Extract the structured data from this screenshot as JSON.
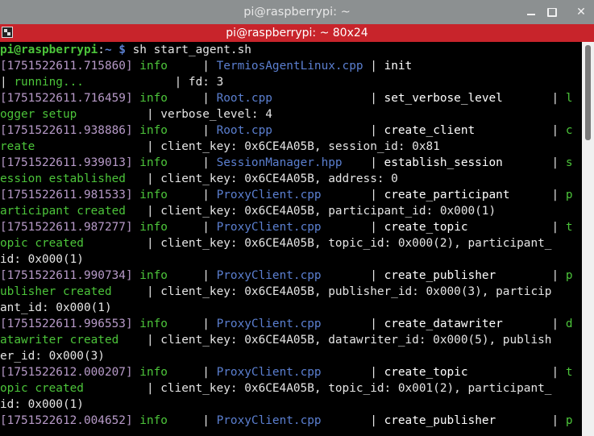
{
  "window": {
    "title": "pi@raspberrypi: ~",
    "minimize_label": "—",
    "maximize_label": "□",
    "close_label": "✕"
  },
  "tab": {
    "label": "pi@raspberrypi: ~ 80x24"
  },
  "terminal": {
    "lines": [
      [
        {
          "t": "pi@raspberrypi",
          "c": "prompt"
        },
        {
          "t": ":",
          "c": "w"
        },
        {
          "t": "~ $",
          "c": "path"
        },
        {
          "t": " sh start_agent.sh",
          "c": "w"
        }
      ],
      [
        {
          "t": "[1751522611.715860]",
          "c": "ts"
        },
        {
          "t": " ",
          "c": "w"
        },
        {
          "t": "info",
          "c": "info"
        },
        {
          "t": "     | ",
          "c": "w"
        },
        {
          "t": "TermiosAgentLinux.cpp",
          "c": "file"
        },
        {
          "t": " | ",
          "c": "w"
        },
        {
          "t": "init",
          "c": "op"
        }
      ],
      [
        {
          "t": "| ",
          "c": "w"
        },
        {
          "t": "running...",
          "c": "desc"
        },
        {
          "t": "             | fd: 3",
          "c": "w"
        }
      ],
      [
        {
          "t": "[1751522611.716459]",
          "c": "ts"
        },
        {
          "t": " ",
          "c": "w"
        },
        {
          "t": "info",
          "c": "info"
        },
        {
          "t": "     | ",
          "c": "w"
        },
        {
          "t": "Root.cpp",
          "c": "file"
        },
        {
          "t": "              | ",
          "c": "w"
        },
        {
          "t": "set_verbose_level",
          "c": "op"
        },
        {
          "t": "       | ",
          "c": "w"
        },
        {
          "t": "l",
          "c": "desc"
        }
      ],
      [
        {
          "t": "ogger setup",
          "c": "desc"
        },
        {
          "t": "          | verbose_level: 4",
          "c": "w"
        }
      ],
      [
        {
          "t": "[1751522611.938886]",
          "c": "ts"
        },
        {
          "t": " ",
          "c": "w"
        },
        {
          "t": "info",
          "c": "info"
        },
        {
          "t": "     | ",
          "c": "w"
        },
        {
          "t": "Root.cpp",
          "c": "file"
        },
        {
          "t": "              | ",
          "c": "w"
        },
        {
          "t": "create_client",
          "c": "op"
        },
        {
          "t": "           | ",
          "c": "w"
        },
        {
          "t": "c",
          "c": "desc"
        }
      ],
      [
        {
          "t": "reate",
          "c": "desc"
        },
        {
          "t": "                | client_key: 0x6CE4A05B, session_id: 0x81",
          "c": "w"
        }
      ],
      [
        {
          "t": "[1751522611.939013]",
          "c": "ts"
        },
        {
          "t": " ",
          "c": "w"
        },
        {
          "t": "info",
          "c": "info"
        },
        {
          "t": "     | ",
          "c": "w"
        },
        {
          "t": "SessionManager.hpp",
          "c": "file"
        },
        {
          "t": "    | ",
          "c": "w"
        },
        {
          "t": "establish_session",
          "c": "op"
        },
        {
          "t": "       | ",
          "c": "w"
        },
        {
          "t": "s",
          "c": "desc"
        }
      ],
      [
        {
          "t": "ession established",
          "c": "desc"
        },
        {
          "t": "   | client_key: 0x6CE4A05B, address: 0",
          "c": "w"
        }
      ],
      [
        {
          "t": "[1751522611.981533]",
          "c": "ts"
        },
        {
          "t": " ",
          "c": "w"
        },
        {
          "t": "info",
          "c": "info"
        },
        {
          "t": "     | ",
          "c": "w"
        },
        {
          "t": "ProxyClient.cpp",
          "c": "file"
        },
        {
          "t": "       | ",
          "c": "w"
        },
        {
          "t": "create_participant",
          "c": "op"
        },
        {
          "t": "      | ",
          "c": "w"
        },
        {
          "t": "p",
          "c": "desc"
        }
      ],
      [
        {
          "t": "articipant created",
          "c": "desc"
        },
        {
          "t": "   | client_key: 0x6CE4A05B, participant_id: 0x000(1)",
          "c": "w"
        }
      ],
      [
        {
          "t": "[1751522611.987277]",
          "c": "ts"
        },
        {
          "t": " ",
          "c": "w"
        },
        {
          "t": "info",
          "c": "info"
        },
        {
          "t": "     | ",
          "c": "w"
        },
        {
          "t": "ProxyClient.cpp",
          "c": "file"
        },
        {
          "t": "       | ",
          "c": "w"
        },
        {
          "t": "create_topic",
          "c": "op"
        },
        {
          "t": "            | ",
          "c": "w"
        },
        {
          "t": "t",
          "c": "desc"
        }
      ],
      [
        {
          "t": "opic created",
          "c": "desc"
        },
        {
          "t": "         | client_key: 0x6CE4A05B, topic_id: 0x000(2), participant_",
          "c": "w"
        }
      ],
      [
        {
          "t": "id: 0x000(1)",
          "c": "w"
        }
      ],
      [
        {
          "t": "[1751522611.990734]",
          "c": "ts"
        },
        {
          "t": " ",
          "c": "w"
        },
        {
          "t": "info",
          "c": "info"
        },
        {
          "t": "     | ",
          "c": "w"
        },
        {
          "t": "ProxyClient.cpp",
          "c": "file"
        },
        {
          "t": "       | ",
          "c": "w"
        },
        {
          "t": "create_publisher",
          "c": "op"
        },
        {
          "t": "        | ",
          "c": "w"
        },
        {
          "t": "p",
          "c": "desc"
        }
      ],
      [
        {
          "t": "ublisher created",
          "c": "desc"
        },
        {
          "t": "     | client_key: 0x6CE4A05B, publisher_id: 0x000(3), particip",
          "c": "w"
        }
      ],
      [
        {
          "t": "ant_id: 0x000(1)",
          "c": "w"
        }
      ],
      [
        {
          "t": "[1751522611.996553]",
          "c": "ts"
        },
        {
          "t": " ",
          "c": "w"
        },
        {
          "t": "info",
          "c": "info"
        },
        {
          "t": "     | ",
          "c": "w"
        },
        {
          "t": "ProxyClient.cpp",
          "c": "file"
        },
        {
          "t": "       | ",
          "c": "w"
        },
        {
          "t": "create_datawriter",
          "c": "op"
        },
        {
          "t": "       | ",
          "c": "w"
        },
        {
          "t": "d",
          "c": "desc"
        }
      ],
      [
        {
          "t": "atawriter created",
          "c": "desc"
        },
        {
          "t": "    | client_key: 0x6CE4A05B, datawriter_id: 0x000(5), publish",
          "c": "w"
        }
      ],
      [
        {
          "t": "er_id: 0x000(3)",
          "c": "w"
        }
      ],
      [
        {
          "t": "[1751522612.000207]",
          "c": "ts"
        },
        {
          "t": " ",
          "c": "w"
        },
        {
          "t": "info",
          "c": "info"
        },
        {
          "t": "     | ",
          "c": "w"
        },
        {
          "t": "ProxyClient.cpp",
          "c": "file"
        },
        {
          "t": "       | ",
          "c": "w"
        },
        {
          "t": "create_topic",
          "c": "op"
        },
        {
          "t": "            | ",
          "c": "w"
        },
        {
          "t": "t",
          "c": "desc"
        }
      ],
      [
        {
          "t": "opic created",
          "c": "desc"
        },
        {
          "t": "         | client_key: 0x6CE4A05B, topic_id: 0x001(2), participant_",
          "c": "w"
        }
      ],
      [
        {
          "t": "id: 0x000(1)",
          "c": "w"
        }
      ],
      [
        {
          "t": "[1751522612.004652]",
          "c": "ts"
        },
        {
          "t": " ",
          "c": "w"
        },
        {
          "t": "info",
          "c": "info"
        },
        {
          "t": "     | ",
          "c": "w"
        },
        {
          "t": "ProxyClient.cpp",
          "c": "file"
        },
        {
          "t": "       | ",
          "c": "w"
        },
        {
          "t": "create_publisher",
          "c": "op"
        },
        {
          "t": "        | ",
          "c": "w"
        },
        {
          "t": "p",
          "c": "desc"
        }
      ]
    ]
  },
  "colors": {
    "titlebar_bg": "#8c9091",
    "tabbar_bg": "#c8242b",
    "timestamp": "#b79ac8",
    "info": "#4cc43a",
    "filename": "#5b7fd0",
    "prompt": "#4cc43a"
  }
}
